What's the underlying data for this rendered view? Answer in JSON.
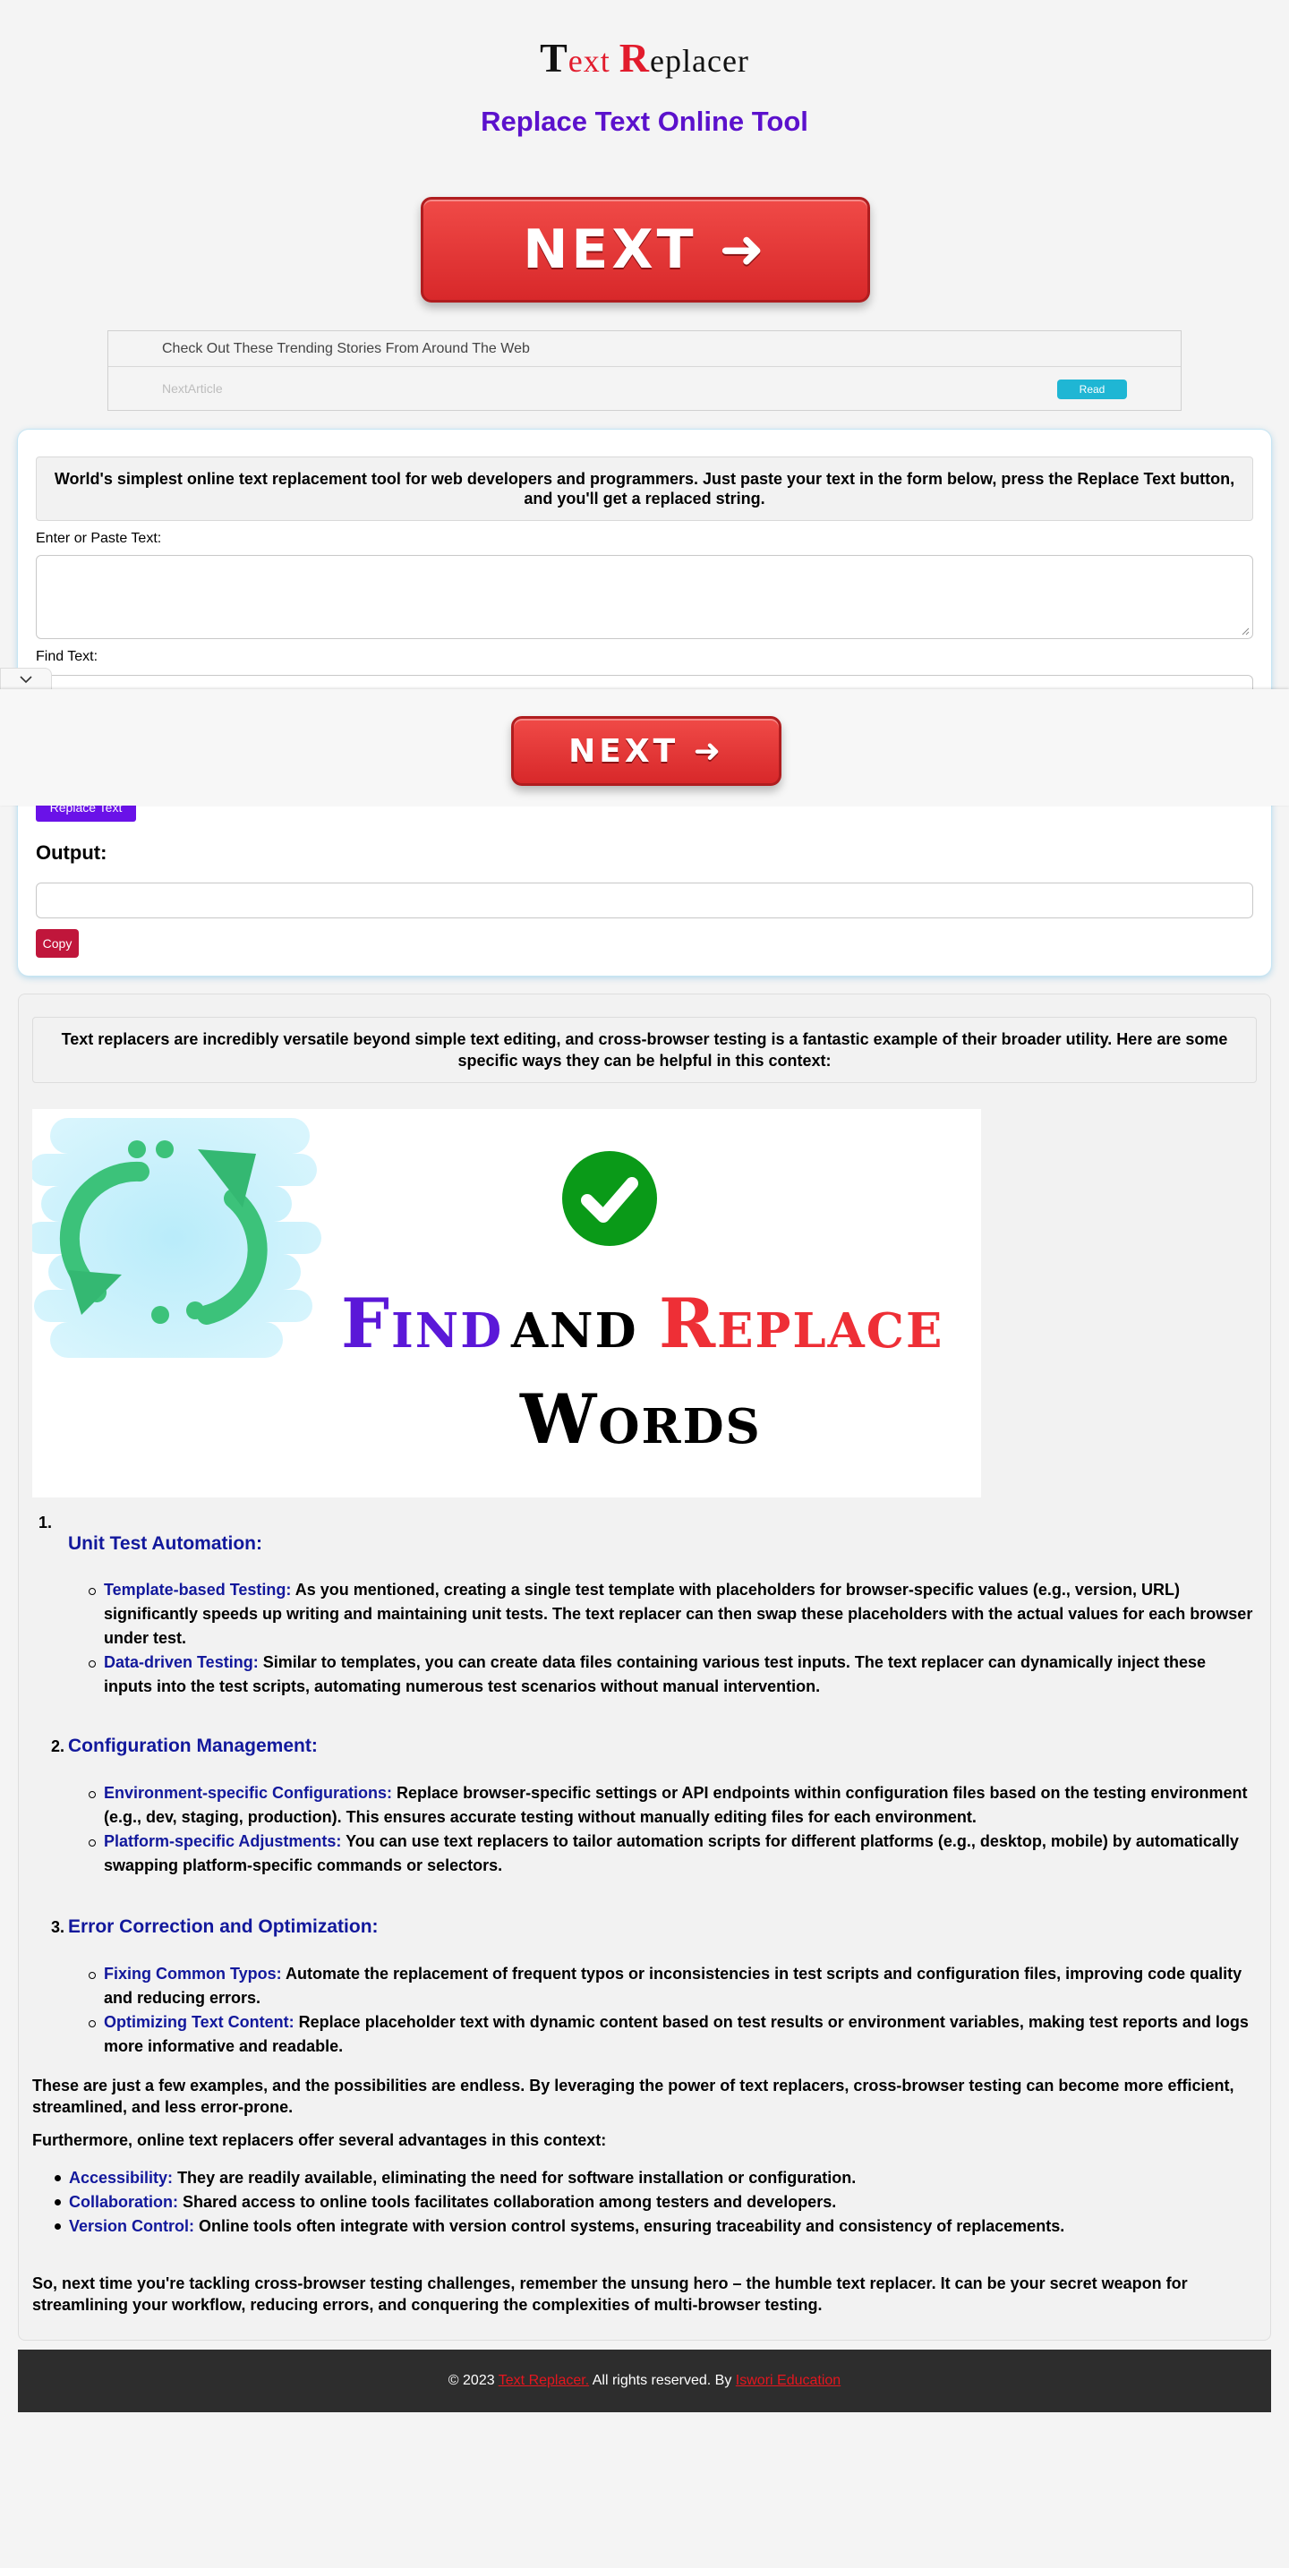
{
  "header": {
    "logo_part1_initial": "T",
    "logo_part1_rest": "ext",
    "logo_part2_initial": "R",
    "logo_part2_rest": "eplacer",
    "title": "Replace Text Online Tool"
  },
  "next_button": {
    "label": "NEXT ➜"
  },
  "trending": {
    "heading": "Check Out These Trending Stories From Around The Web",
    "item_label": "NextArticle",
    "read_label": "Read"
  },
  "tool": {
    "intro": "World's simplest online text replacement tool for web developers and programmers. Just paste your text in the form below, press the Replace Text button, and you'll get a replaced string.",
    "input_label": "Enter or Paste Text:",
    "find_label": "Find Text:",
    "replace_button": "Replace Text",
    "output_title": "Output:",
    "copy_button": "Copy"
  },
  "article": {
    "intro": "Text replacers are incredibly versatile beyond simple text editing, and cross-browser testing is a fantastic example of their broader utility. Here are some specific ways they can be helpful in this context:",
    "hero": {
      "word1": "Find",
      "word2": "and",
      "word3": "Replace",
      "word4": "Words"
    },
    "sections": [
      {
        "num": "1.",
        "title": "Unit Test Automation:",
        "bullets": [
          {
            "term": "Template-based Testing:",
            "text": " As you mentioned, creating a single test template with placeholders for browser-specific values (e.g., version, URL) significantly speeds up writing and maintaining unit tests. The text replacer can then swap these placeholders with the actual values for each browser under test."
          },
          {
            "term": "Data-driven Testing:",
            "text": " Similar to templates, you can create data files containing various test inputs. The text replacer can dynamically inject these inputs into the test scripts, automating numerous test scenarios without manual intervention."
          }
        ]
      },
      {
        "num": "2.",
        "title": "Configuration Management:",
        "bullets": [
          {
            "term": "Environment-specific Configurations:",
            "text": " Replace browser-specific settings or API endpoints within configuration files based on the testing environment (e.g., dev, staging, production). This ensures accurate testing without manually editing files for each environment."
          },
          {
            "term": "Platform-specific Adjustments:",
            "text": " You can use text replacers to tailor automation scripts for different platforms (e.g., desktop, mobile) by automatically swapping platform-specific commands or selectors."
          }
        ]
      },
      {
        "num": "3.",
        "title": "Error Correction and Optimization:",
        "bullets": [
          {
            "term": "Fixing Common Typos:",
            "text": " Automate the replacement of frequent typos or inconsistencies in test scripts and configuration files, improving code quality and reducing errors."
          },
          {
            "term": "Optimizing Text Content:",
            "text": " Replace placeholder text with dynamic content based on test results or environment variables, making test reports and logs more informative and readable."
          }
        ]
      }
    ],
    "para1": "These are just a few examples, and the possibilities are endless. By leveraging the power of text replacers, cross-browser testing can become more efficient, streamlined, and less error-prone.",
    "para2": "Furthermore, online text replacers offer several advantages in this context:",
    "advantages": [
      {
        "term": "Accessibility:",
        "text": " They are readily available, eliminating the need for software installation or configuration."
      },
      {
        "term": "Collaboration:",
        "text": " Shared access to online tools facilitates collaboration among testers and developers."
      },
      {
        "term": "Version Control:",
        "text": " Online tools often integrate with version control systems, ensuring traceability and consistency of replacements."
      }
    ],
    "closing": "So, next time you're tackling cross-browser testing challenges, remember the unsung hero – the humble text replacer. It can be your secret weapon for streamlining your workflow, reducing errors, and conquering the complexities of multi-browser testing."
  },
  "footer": {
    "prefix": "© 2023 ",
    "site_link": "Text Replacer.",
    "middle": " All rights reserved. By ",
    "author_link": "Iswori Education"
  }
}
